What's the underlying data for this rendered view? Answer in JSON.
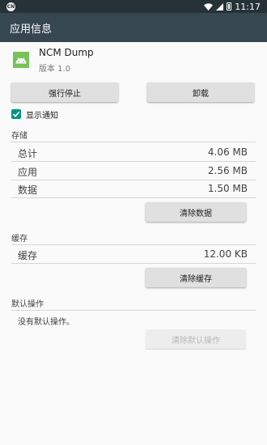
{
  "status_bar": {
    "badge": "CN",
    "time": "11:17"
  },
  "toolbar": {
    "title": "应用信息"
  },
  "app": {
    "name": "NCM Dump",
    "version": "版本 1.0",
    "icon": "android-icon"
  },
  "buttons": {
    "force_stop": "强行停止",
    "uninstall": "卸载"
  },
  "notification": {
    "label": "显示通知",
    "checked": true
  },
  "storage": {
    "title": "存储",
    "rows": [
      {
        "label": "总计",
        "value": "4.06 MB"
      },
      {
        "label": "应用",
        "value": "2.56 MB"
      },
      {
        "label": "数据",
        "value": "1.50 MB"
      }
    ],
    "clear_button": "清除数据"
  },
  "cache": {
    "title": "缓存",
    "rows": [
      {
        "label": "缓存",
        "value": "12.00 KB"
      }
    ],
    "clear_button": "清除缓存"
  },
  "defaults": {
    "title": "默认操作",
    "text": "没有默认操作。",
    "clear_button": "清除默认操作"
  },
  "colors": {
    "status_bar": "#263238",
    "toolbar": "#37474f",
    "accent": "#009688",
    "android_green": "#78c257"
  }
}
